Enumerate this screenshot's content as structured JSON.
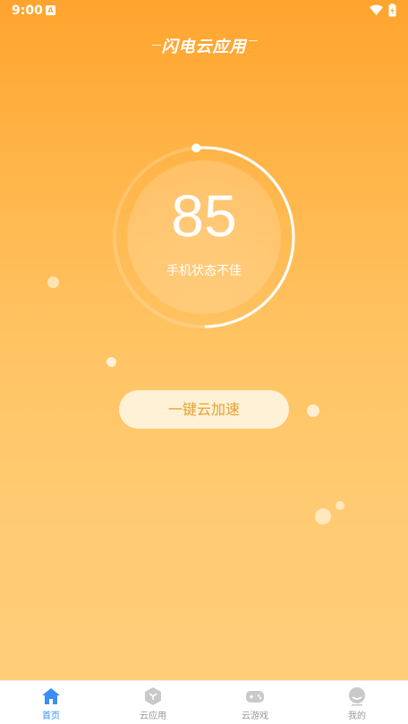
{
  "status_bar": {
    "time": "9:00",
    "notification_badge": "A"
  },
  "header": {
    "title": "闪电云应用"
  },
  "gauge": {
    "score": "85",
    "status": "手机状态不佳",
    "progress": 0.85
  },
  "actions": {
    "accelerate_label": "一键云加速"
  },
  "tabs": [
    {
      "label": "首页",
      "icon": "home-icon",
      "active": true
    },
    {
      "label": "云应用",
      "icon": "cube-icon",
      "active": false
    },
    {
      "label": "云游戏",
      "icon": "gamepad-icon",
      "active": false
    },
    {
      "label": "我的",
      "icon": "user-icon",
      "active": false
    }
  ],
  "colors": {
    "accent": "#3A8EF6",
    "background_top": "#FFA42E",
    "background_bottom": "#FFCE7A",
    "button_text": "#E5A030"
  }
}
